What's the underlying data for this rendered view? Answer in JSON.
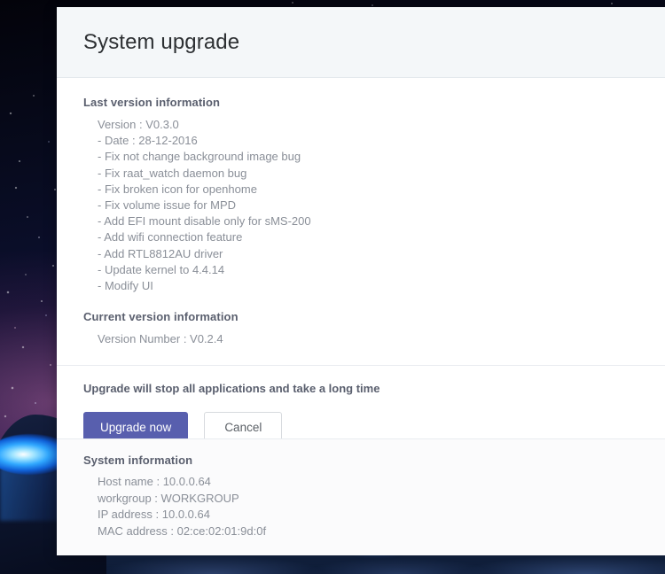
{
  "dialog": {
    "title": "System upgrade",
    "last_version": {
      "heading": "Last version information",
      "lines": [
        "Version : V0.3.0",
        "- Date : 28-12-2016",
        "- Fix not change background image bug",
        "- Fix raat_watch daemon bug",
        "- Fix broken icon for openhome",
        "- Fix volume issue for MPD",
        "- Add EFI mount disable only for sMS-200",
        "- Add wifi connection feature",
        "- Add RTL8812AU driver",
        "- Update kernel to 4.4.14",
        "- Modify UI"
      ]
    },
    "current_version": {
      "heading": "Current version information",
      "lines": [
        "Version Number : V0.2.4"
      ]
    },
    "warning": "Upgrade will stop all applications and take a long time",
    "actions": {
      "primary_label": "Upgrade now",
      "secondary_label": "Cancel"
    },
    "system_information": {
      "heading": "System information",
      "lines": [
        "Host name : 10.0.0.64",
        "workgroup : WORKGROUP",
        "IP address : 10.0.0.64",
        "MAC address : 02:ce:02:01:9d:0f"
      ]
    }
  },
  "colors": {
    "primary_button": "#585fae",
    "header_background": "#f4f7f9",
    "heading_text": "#5a5f6e",
    "body_text": "#8a8f98"
  }
}
